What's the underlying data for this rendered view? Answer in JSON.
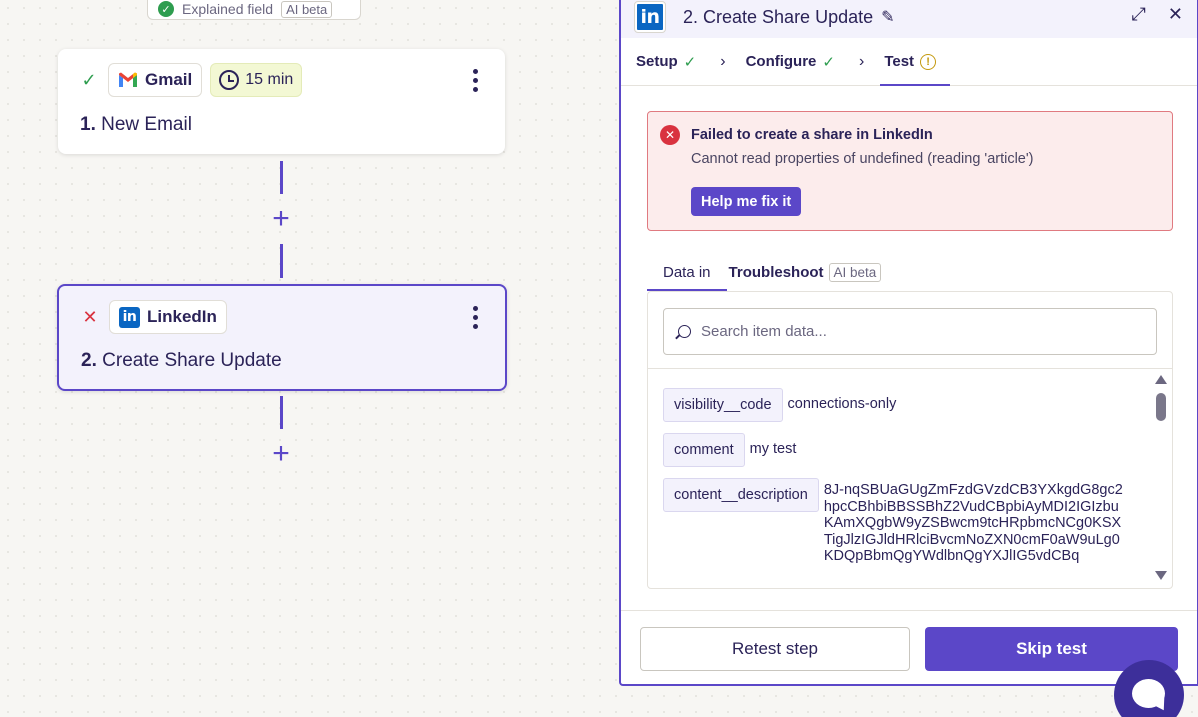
{
  "canvas": {
    "top_chip": {
      "label": "Explained field",
      "badge": "AI beta"
    },
    "steps": [
      {
        "status": "success",
        "app": "Gmail",
        "delay": "15 min",
        "number": "1.",
        "title": "New Email"
      },
      {
        "status": "error",
        "app": "LinkedIn",
        "number": "2.",
        "title": "Create Share Update"
      }
    ],
    "plus_label": "+"
  },
  "panel": {
    "app_logo_text": "in",
    "title": "2. Create Share Update",
    "tabs": [
      {
        "label": "Setup",
        "state": "complete"
      },
      {
        "label": "Configure",
        "state": "complete"
      },
      {
        "label": "Test",
        "state": "warning"
      }
    ],
    "error": {
      "title": "Failed to create a share in LinkedIn",
      "message": "Cannot read properties of undefined (reading 'article')",
      "fix_button": "Help me fix it"
    },
    "subtabs": {
      "data_in": "Data in",
      "troubleshoot": "Troubleshoot",
      "badge": "AI beta"
    },
    "search": {
      "placeholder": "Search item data..."
    },
    "rows": [
      {
        "key": "visibility__code",
        "value": "connections-only"
      },
      {
        "key": "comment",
        "value": "my test"
      },
      {
        "key": "content__description",
        "value": "8J-nqSBUaGUgZmFzdGVzdCB3YXkgdG8gc2hpcCBhbiBBSSBhZ2VudCBpbiAyMDI2IGIzbuKAmXQgbW9yZSBwcm9tcHRpbmcNCg0KSXTigJlzIGJldHRlciBvcmNoZXN0cmF0aW9uLg0KDQpBbmQgYWdlbnQgYXJlIG5vdCBq"
      }
    ],
    "footer": {
      "retest": "Retest step",
      "skip": "Skip test"
    }
  },
  "colors": {
    "accent": "#5b47c8",
    "success": "#2e9d4f",
    "error": "#d9323f",
    "linkedin": "#0a66c2"
  }
}
